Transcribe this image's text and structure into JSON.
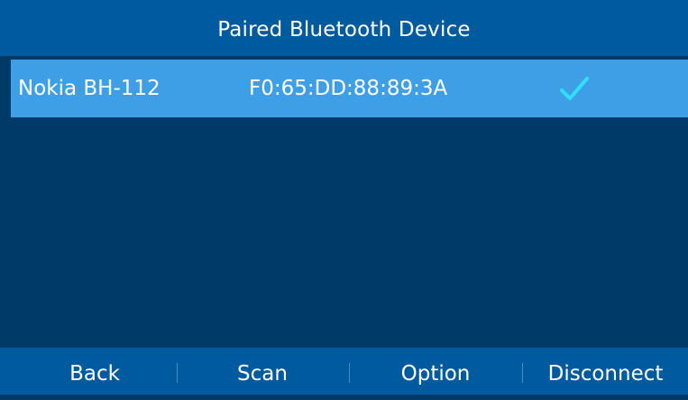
{
  "header": {
    "title": "Paired Bluetooth Device"
  },
  "devices": [
    {
      "name": "Nokia BH-112",
      "mac": "F0:65:DD:88:89:3A",
      "connected_icon": "checkmark-icon",
      "selected": true
    }
  ],
  "softkeys": {
    "back": "Back",
    "scan": "Scan",
    "option": "Option",
    "disconnect": "Disconnect"
  },
  "colors": {
    "background": "#003a68",
    "bar": "#005a9e",
    "selected_row": "#3f9fe6",
    "check": "#2fe0ff",
    "text": "#ffffff"
  }
}
